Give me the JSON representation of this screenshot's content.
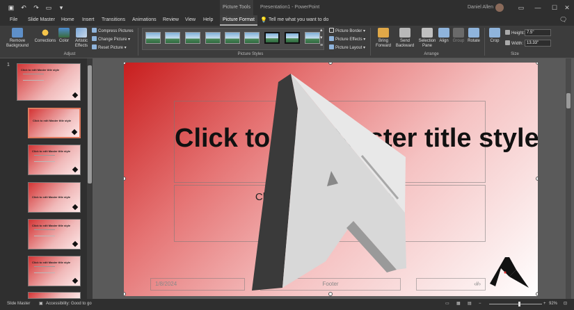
{
  "titlebar": {
    "context_tab": "Picture Tools",
    "document": "Presentation1 - PowerPoint",
    "user": "Daniel Allen"
  },
  "tabs": [
    "File",
    "Slide Master",
    "Home",
    "Insert",
    "Transitions",
    "Animations",
    "Review",
    "View",
    "Help",
    "Picture Format"
  ],
  "tell_me": "Tell me what you want to do",
  "ribbon": {
    "remove_background": "Remove Background",
    "corrections": "Corrections",
    "color": "Color",
    "artistic_effects": "Artistic Effects",
    "compress": "Compress Pictures",
    "change": "Change Picture",
    "reset": "Reset Picture",
    "group_adjust": "Adjust",
    "group_styles": "Picture Styles",
    "picture_border": "Picture Border",
    "picture_effects": "Picture Effects",
    "picture_layout": "Picture Layout",
    "bring_forward": "Bring Forward",
    "send_backward": "Send Backward",
    "selection_pane": "Selection Pane",
    "align": "Align",
    "group": "Group",
    "rotate": "Rotate",
    "group_arrange": "Arrange",
    "crop": "Crop",
    "height_label": "Height:",
    "height_value": "7.5\"",
    "width_label": "Width:",
    "width_value": "13.33\"",
    "group_size": "Size"
  },
  "panel": {
    "slide_number": "1",
    "master_title": "Click to edit Master title style",
    "layout_title": "Click to edit Master title style"
  },
  "slide": {
    "title": "Click to edit Master title style",
    "subtitle": "Click to edit Master subtitle style",
    "date": "1/8/2024",
    "footer": "Footer",
    "page_number": "‹#›"
  },
  "status": {
    "view": "Slide Master",
    "accessibility": "Accessibility: Good to go",
    "zoom": "92%"
  },
  "colors": {
    "accent": "#c81e1e",
    "ribbon_bg": "#3c3c3c",
    "workspace_bg": "#5a5a5a"
  }
}
